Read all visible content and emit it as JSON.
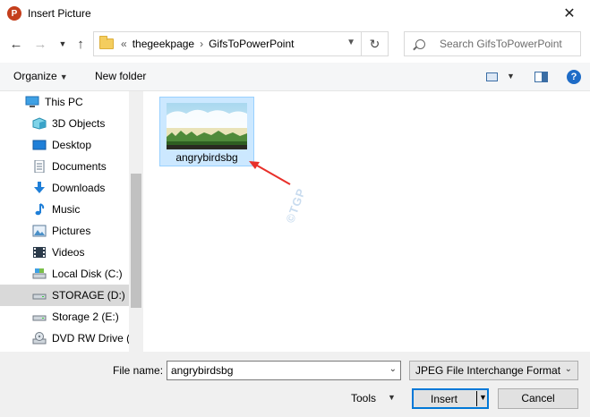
{
  "window": {
    "title": "Insert Picture",
    "app_icon_letter": "P",
    "close_glyph": "✕"
  },
  "address": {
    "overflow_glyph": "«",
    "crumbs": [
      "thegeekpage",
      "GifsToPowerPoint"
    ],
    "separator": "›"
  },
  "search": {
    "placeholder": "Search GifsToPowerPoint"
  },
  "toolbar": {
    "organize_label": "Organize",
    "new_folder_label": "New folder",
    "help_glyph": "?"
  },
  "nav": {
    "items": [
      {
        "label": "This PC",
        "icon": "this-pc-icon"
      },
      {
        "label": "3D Objects",
        "icon": "cube-icon"
      },
      {
        "label": "Desktop",
        "icon": "desktop-icon"
      },
      {
        "label": "Documents",
        "icon": "document-icon"
      },
      {
        "label": "Downloads",
        "icon": "download-icon"
      },
      {
        "label": "Music",
        "icon": "music-icon"
      },
      {
        "label": "Pictures",
        "icon": "pictures-icon"
      },
      {
        "label": "Videos",
        "icon": "video-icon"
      },
      {
        "label": "Local Disk (C:)",
        "icon": "disk-icon"
      },
      {
        "label": "STORAGE (D:)",
        "icon": "drive-icon",
        "selected": true
      },
      {
        "label": "Storage 2 (E:)",
        "icon": "drive-icon"
      },
      {
        "label": "DVD RW Drive (C",
        "icon": "dvd-icon"
      }
    ]
  },
  "content": {
    "files": [
      {
        "name": "angrybirdsbg",
        "selected": true
      }
    ],
    "watermark": "©TGP"
  },
  "bottom": {
    "file_name_label": "File name:",
    "file_name_value": "angrybirdsbg",
    "file_type_value": "JPEG File Interchange Format",
    "tools_label": "Tools",
    "insert_label": "Insert",
    "cancel_label": "Cancel"
  },
  "colors": {
    "accent": "#0078d7",
    "selection_bg": "#cce8ff",
    "arrow": "#e8302a"
  }
}
